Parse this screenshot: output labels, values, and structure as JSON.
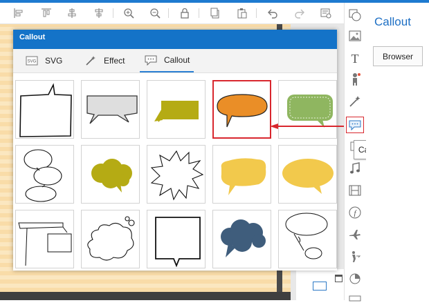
{
  "toolbar": {
    "icons": [
      "align-left-icon",
      "align-top-icon",
      "align-center-icon",
      "distribute-icon",
      "zoom-in-icon",
      "zoom-out-icon",
      "lock-icon",
      "copy-icon",
      "paste-icon",
      "undo-icon",
      "redo-icon",
      "properties-icon"
    ]
  },
  "dialog": {
    "title": "Callout",
    "tabs": [
      {
        "label": "SVG",
        "icon": "svg-icon"
      },
      {
        "label": "Effect",
        "icon": "magic-wand-icon"
      },
      {
        "label": "Callout",
        "icon": "callout-icon",
        "active": true
      }
    ],
    "callouts": [
      "rough-rect-callout",
      "gray-ribbon-callout",
      "olive-rect-callout",
      "orange-oval-callout",
      "green-dotted-callout",
      "thought-bubble-callout",
      "olive-cloud-callout",
      "starburst-callout",
      "yellow-blob-callout",
      "yellow-oval-callout",
      "double-box-callout",
      "cloud-callout",
      "square-callout",
      "navy-cloud-callout",
      "scribble-oval-callout"
    ],
    "selected_index": 3
  },
  "vertical_toolbar": {
    "icons": [
      "shape-icon",
      "image-icon",
      "text-icon",
      "character-icon",
      "magic-wand-icon",
      "callout-icon",
      "layer-icon",
      "music-icon",
      "video-icon",
      "function-icon",
      "airplane-icon",
      "pointer-icon",
      "pie-chart-icon",
      "more-icon"
    ],
    "tooltip": "Callout"
  },
  "right_panel": {
    "title": "Callout",
    "browse_label": "Browser"
  },
  "colors": {
    "accent": "#1473c8",
    "highlight": "#d8262d",
    "orange": "#ea8e27",
    "olive": "#b5ab14",
    "green": "#8fb660",
    "yellow": "#f2c94c",
    "navy": "#3f5d7c"
  }
}
